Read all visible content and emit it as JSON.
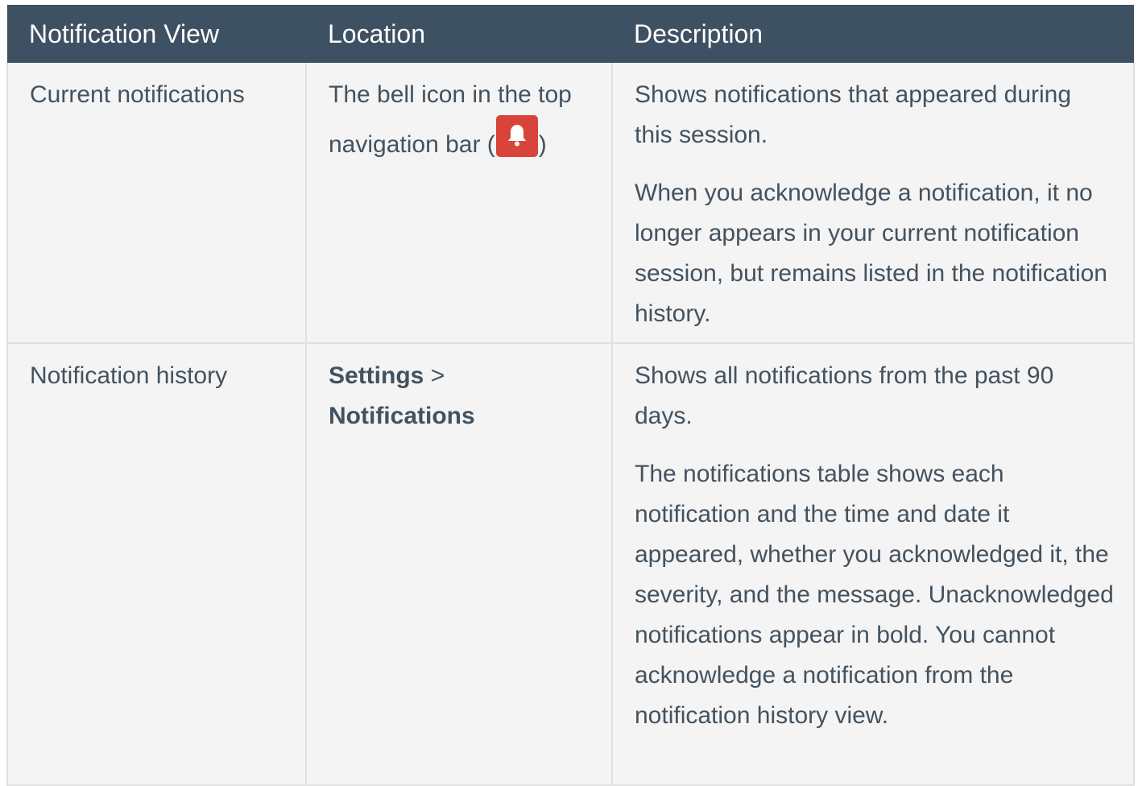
{
  "table": {
    "headers": [
      "Notification View",
      "Location",
      "Description"
    ],
    "rows": [
      {
        "view": "Current notifications",
        "location": {
          "line1": "The bell icon in the top",
          "prefix": "navigation bar (",
          "icon": "bell-icon",
          "suffix": ")"
        },
        "description": [
          "Shows notifications that appeared during this session.",
          "When you acknowledge a notification, it no longer appears in your current notification session, but remains listed in the notification history."
        ]
      },
      {
        "view": "Notification history",
        "location": {
          "menu": "Settings",
          "separator": " > ",
          "item": "Notifications"
        },
        "description": [
          "Shows all notifications from the past 90 days.",
          "The notifications table shows each notification and the time and date it appeared, whether you acknowledged it, the severity, and the message. Unacknowledged notifications appear in bold. You cannot acknowledge a notification from the notification history view."
        ]
      }
    ]
  },
  "colors": {
    "header_background": "#3e5163",
    "header_text": "#ffffff",
    "body_text": "#43525f",
    "cell_background": "#f4f4f4",
    "bell_badge": "#d9443a"
  }
}
